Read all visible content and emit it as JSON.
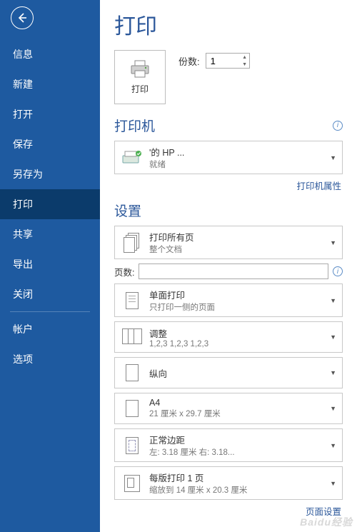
{
  "sidebar": {
    "items": [
      {
        "label": "信息"
      },
      {
        "label": "新建"
      },
      {
        "label": "打开"
      },
      {
        "label": "保存"
      },
      {
        "label": "另存为"
      },
      {
        "label": "打印"
      },
      {
        "label": "共享"
      },
      {
        "label": "导出"
      },
      {
        "label": "关闭"
      }
    ],
    "bottom": [
      {
        "label": "帐户"
      },
      {
        "label": "选项"
      }
    ]
  },
  "title": "打印",
  "printButton": {
    "label": "打印"
  },
  "copies": {
    "label": "份数:",
    "value": "1"
  },
  "printerSection": {
    "title": "打印机"
  },
  "printer": {
    "name": "'的 HP ...",
    "status": "就绪"
  },
  "printerPropsLink": "打印机属性",
  "settingsSection": {
    "title": "设置"
  },
  "settings": {
    "scope": {
      "title": "打印所有页",
      "sub": "整个文档"
    },
    "pagesLabel": "页数:",
    "side": {
      "title": "单面打印",
      "sub": "只打印一侧的页面"
    },
    "collate": {
      "title": "调整",
      "sub": "1,2,3    1,2,3    1,2,3"
    },
    "orient": {
      "title": "纵向",
      "sub": ""
    },
    "paper": {
      "title": "A4",
      "sub": "21 厘米 x 29.7 厘米"
    },
    "margins": {
      "title": "正常边距",
      "sub": "左: 3.18 厘米   右: 3.18..."
    },
    "perSheet": {
      "title": "每版打印 1 页",
      "sub": "缩放到 14 厘米 x 20.3 厘米"
    }
  },
  "pageSetupLink": "页面设置",
  "watermark": "Baidu经验"
}
